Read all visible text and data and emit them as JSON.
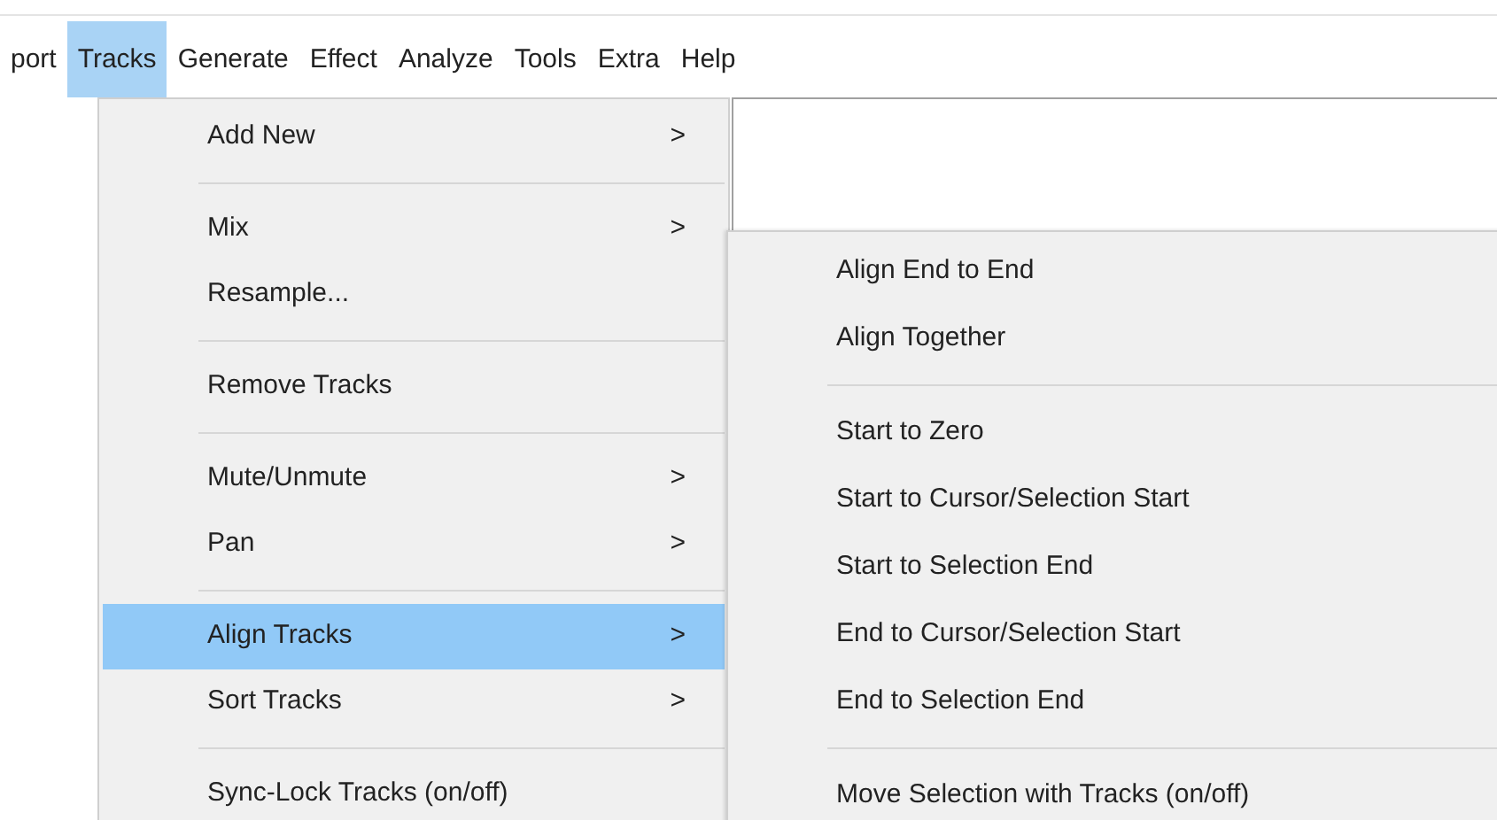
{
  "menu_bar": [
    {
      "label": "port",
      "selected": false
    },
    {
      "label": "Tracks",
      "selected": true
    },
    {
      "label": "Generate",
      "selected": false
    },
    {
      "label": "Effect",
      "selected": false
    },
    {
      "label": "Analyze",
      "selected": false
    },
    {
      "label": "Tools",
      "selected": false
    },
    {
      "label": "Extra",
      "selected": false
    },
    {
      "label": "Help",
      "selected": false
    }
  ],
  "tracks_menu": [
    {
      "kind": "item",
      "label": "Add New",
      "arrow": ">",
      "selected": false
    },
    {
      "kind": "separator"
    },
    {
      "kind": "item",
      "label": "Mix",
      "arrow": ">",
      "selected": false
    },
    {
      "kind": "item",
      "label": "Resample...",
      "selected": false
    },
    {
      "kind": "separator"
    },
    {
      "kind": "item",
      "label": "Remove Tracks",
      "selected": false
    },
    {
      "kind": "separator"
    },
    {
      "kind": "item",
      "label": "Mute/Unmute",
      "arrow": ">",
      "selected": false
    },
    {
      "kind": "item",
      "label": "Pan",
      "arrow": ">",
      "selected": false
    },
    {
      "kind": "separator"
    },
    {
      "kind": "item",
      "label": "Align Tracks",
      "arrow": ">",
      "selected": true
    },
    {
      "kind": "item",
      "label": "Sort Tracks",
      "arrow": ">",
      "selected": false
    },
    {
      "kind": "separator"
    },
    {
      "kind": "item",
      "label": "Sync-Lock Tracks (on/off)",
      "selected": false
    }
  ],
  "align_tracks_submenu": [
    {
      "kind": "item",
      "label": "Align End to End",
      "selected": false
    },
    {
      "kind": "item",
      "label": "Align Together",
      "selected": false
    },
    {
      "kind": "separator"
    },
    {
      "kind": "item",
      "label": "Start to Zero",
      "selected": false
    },
    {
      "kind": "item",
      "label": "Start to Cursor/Selection Start",
      "selected": false
    },
    {
      "kind": "item",
      "label": "Start to Selection End",
      "selected": false
    },
    {
      "kind": "item",
      "label": "End to Cursor/Selection Start",
      "selected": false
    },
    {
      "kind": "item",
      "label": "End to Selection End",
      "selected": false
    },
    {
      "kind": "separator"
    },
    {
      "kind": "item",
      "label": "Move Selection with Tracks (on/off)",
      "selected": false
    }
  ]
}
